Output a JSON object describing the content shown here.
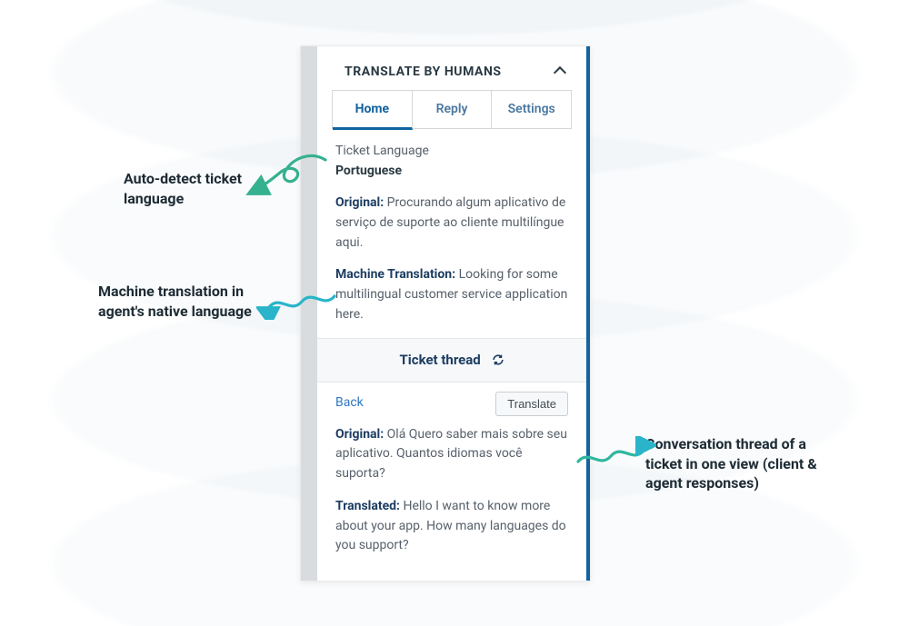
{
  "panel": {
    "title": "TRANSLATE BY HUMANS",
    "tabs": {
      "home": "Home",
      "reply": "Reply",
      "settings": "Settings"
    },
    "language_label": "Ticket Language",
    "language_value": "Portuguese",
    "original_label": "Original:",
    "original_text": "Procurando algum aplicativo de serviço de suporte ao cliente multilíngue aqui.",
    "mt_label": "Machine Translation:",
    "mt_text": "Looking for some multilingual customer service application here.",
    "thread_header": "Ticket thread",
    "back": "Back",
    "translate_btn": "Translate",
    "thread_original_label": "Original:",
    "thread_original_text": "Olá Quero saber mais sobre seu aplicativo. Quantos idiomas você suporta?",
    "thread_translated_label": "Translated:",
    "thread_translated_text": "Hello I want to know more about your app. How many languages do you support?"
  },
  "callouts": {
    "c1": "Auto-detect ticket language",
    "c2": "Machine translation in agent's native language",
    "c3": "Conversation thread of a ticket in one view (client & agent responses)"
  },
  "colors": {
    "accent": "#1263a0",
    "arrow_green": "#35b18f",
    "arrow_teal": "#29b4c9"
  }
}
